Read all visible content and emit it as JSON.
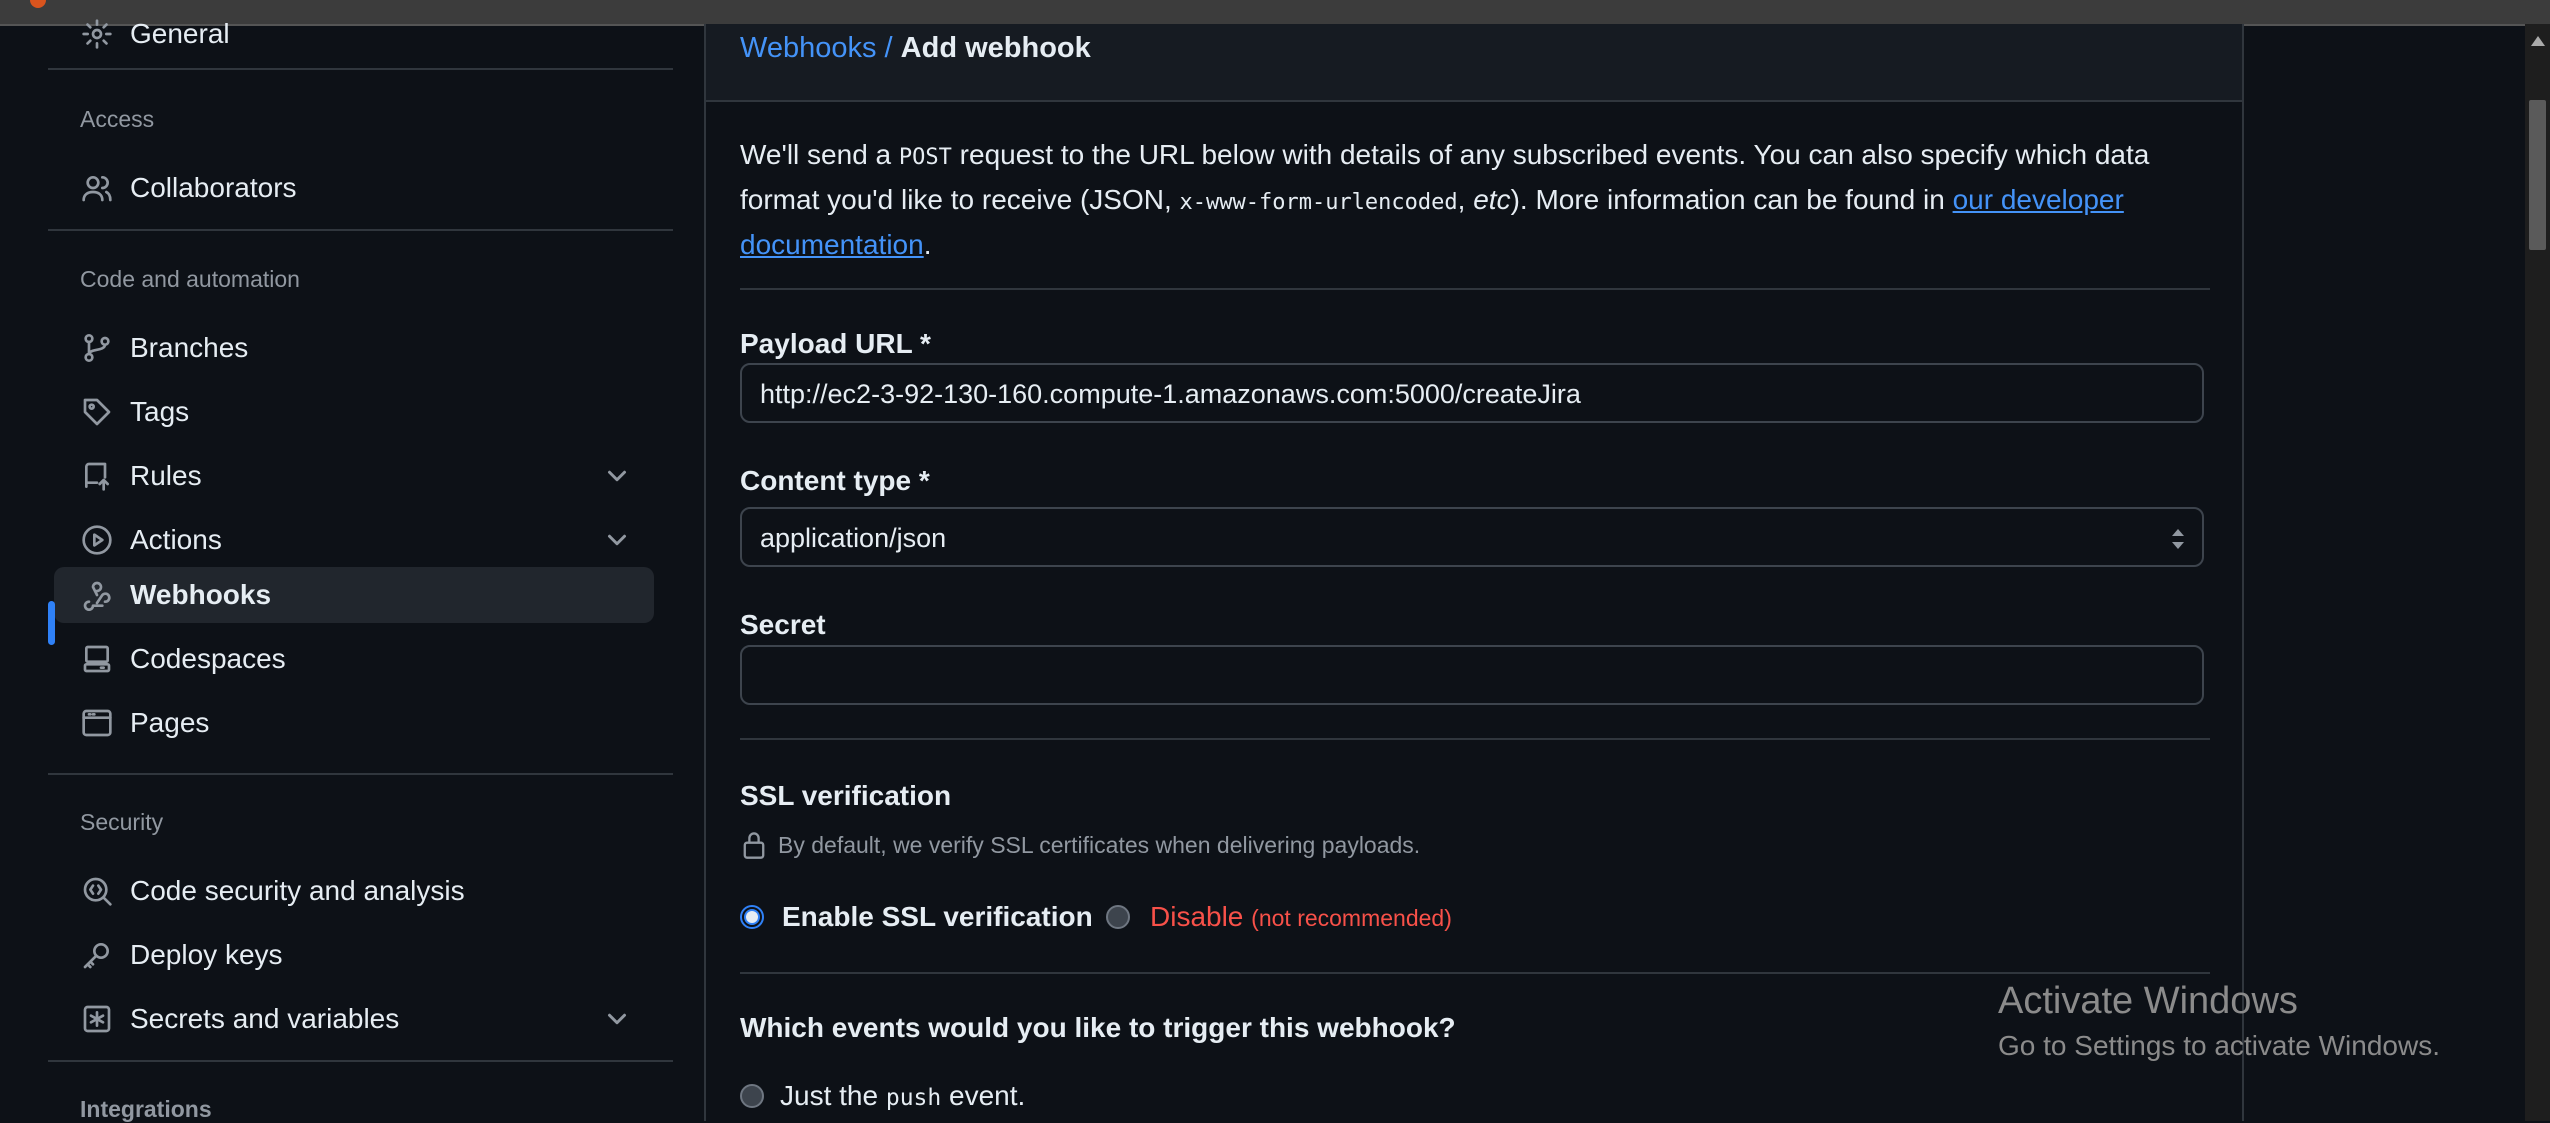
{
  "sidebar": {
    "top_item": "General",
    "sections": {
      "access": "Access",
      "code_automation": "Code and automation",
      "security": "Security",
      "integrations": "Integrations"
    },
    "items": {
      "collaborators": "Collaborators",
      "branches": "Branches",
      "tags": "Tags",
      "rules": "Rules",
      "actions": "Actions",
      "webhooks": "Webhooks",
      "codespaces": "Codespaces",
      "pages": "Pages",
      "code_security": "Code security and analysis",
      "deploy_keys": "Deploy keys",
      "secrets": "Secrets and variables"
    },
    "active_item": "Webhooks"
  },
  "breadcrumb": {
    "parent": "Webhooks",
    "separator": " / ",
    "current": "Add webhook"
  },
  "intro": {
    "t1": "We'll send a ",
    "code1": "POST",
    "t2": " request to the URL below with details of any subscribed events. You can also specify which data format you'd like to receive (JSON, ",
    "code2": "x-www-form-urlencoded",
    "t3": ", ",
    "etc": "etc",
    "t4": "). More information can be found in ",
    "link": "our developer documentation",
    "t5": "."
  },
  "form": {
    "payload_label": "Payload URL *",
    "payload_value": "http://ec2-3-92-130-160.compute-1.amazonaws.com:5000/createJira",
    "content_type_label": "Content type *",
    "content_type_value": "application/json",
    "secret_label": "Secret",
    "secret_value": "",
    "ssl_title": "SSL verification",
    "ssl_note": "By default, we verify SSL certificates when delivering payloads.",
    "ssl_enable": "Enable SSL verification",
    "ssl_disable": "Disable",
    "ssl_disable_note": "(not recommended)",
    "events_question": "Which events would you like to trigger this webhook?",
    "events_push_pre": "Just the ",
    "events_push_code": "push",
    "events_push_post": " event."
  },
  "watermark": {
    "line1": "Activate Windows",
    "line2": "Go to Settings to activate Windows."
  },
  "colors": {
    "accent": "#2f81f7",
    "link": "#4493f8",
    "danger": "#f85149",
    "bg": "#0d1117"
  }
}
